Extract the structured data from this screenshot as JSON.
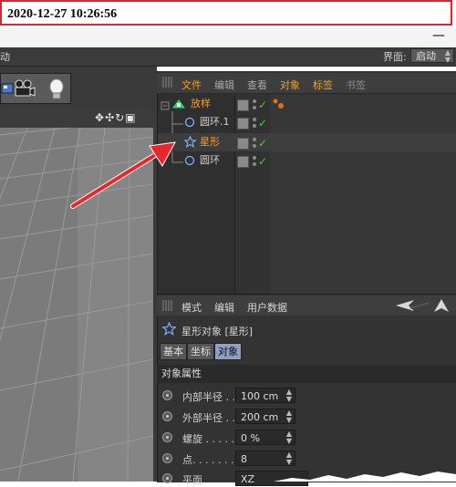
{
  "timestamp": "2020-12-27 10:26:56",
  "window": {
    "minimize_glyph": "—"
  },
  "menubar": {
    "left_partial": "动",
    "layout_label": "界面:",
    "layout_value": "启动"
  },
  "object_manager": {
    "tabs": [
      "文件",
      "编辑",
      "查看",
      "对象",
      "标签",
      "书签"
    ],
    "rows": [
      {
        "name": "放样",
        "icon": "loft-icon"
      },
      {
        "name": "圆环.1",
        "icon": "circle-icon"
      },
      {
        "name": "星形",
        "icon": "star-icon"
      },
      {
        "name": "圆环",
        "icon": "circle-icon"
      }
    ]
  },
  "attribute_manager": {
    "tabs": [
      "模式",
      "编辑",
      "用户数据"
    ],
    "title": "星形对象 [星形]",
    "tab_buttons": [
      "基本",
      "坐标",
      "对象"
    ],
    "section": "对象属性",
    "params": [
      {
        "label": "内部半径 . .",
        "value": "100 cm"
      },
      {
        "label": "外部半径 . .",
        "value": "200 cm"
      },
      {
        "label": "螺旋 . . . . . . .",
        "value": "0 %"
      },
      {
        "label": "点. . . . . . . . .",
        "value": "8"
      },
      {
        "label": "平面",
        "value": "XZ"
      }
    ]
  },
  "colors": {
    "accent_selected": "#f0a030",
    "check": "#3fcf3f",
    "arrow": "#e8262b",
    "active_tab": "#8da0c7"
  }
}
